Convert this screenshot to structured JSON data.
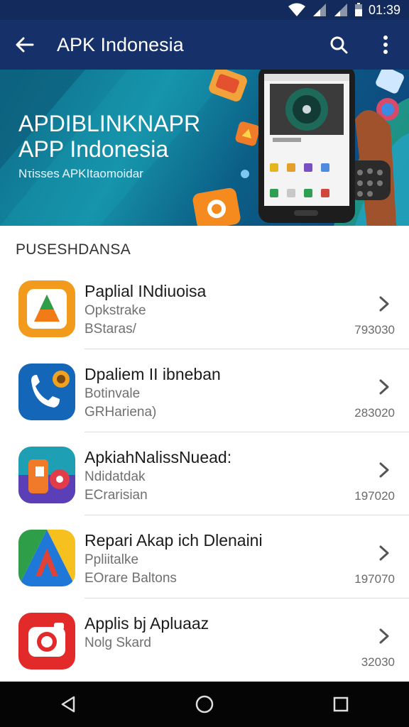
{
  "status_bar": {
    "time": "01:39"
  },
  "app_bar": {
    "title": "APK Indonesia"
  },
  "banner": {
    "headline_line1": "APDIBLINKNAPR",
    "headline_line2": "APP Indonesia",
    "subline": "Ντisses APΚΙtaomoidar"
  },
  "section": {
    "title": "PUSESHDANSA"
  },
  "apps": [
    {
      "name": "Paplial INdiuoisa",
      "line1": "Opkstrake",
      "line2": "BStaras/",
      "count": "793030"
    },
    {
      "name": "Dpaliem II ibneban",
      "line1": "Botinvale",
      "line2": "GRHariena)",
      "count": "283020"
    },
    {
      "name": "ApkiahNalissNuead:",
      "line1": "Ndidatdak",
      "line2": "ECrarisian",
      "count": "197020"
    },
    {
      "name": "Repari Akap ich Dlenaini",
      "line1": "Ppliitalke",
      "line2": "EOrare Baltons",
      "count": "197070"
    },
    {
      "name": "Applis bj Apluaaz",
      "line1": "",
      "line2": "Nolg Skard",
      "count": "32030"
    }
  ],
  "icons": {
    "status": [
      "wifi-icon",
      "signal-icon",
      "signal-icon",
      "battery-icon"
    ],
    "app_bar": [
      "back-arrow-icon",
      "search-icon",
      "more-vert-icon"
    ],
    "nav": [
      "back-triangle-icon",
      "home-circle-icon",
      "recents-square-icon"
    ]
  },
  "colors": {
    "app_bar": "#16306a",
    "status_bar": "#122a5c",
    "nav_bar": "#050505"
  }
}
